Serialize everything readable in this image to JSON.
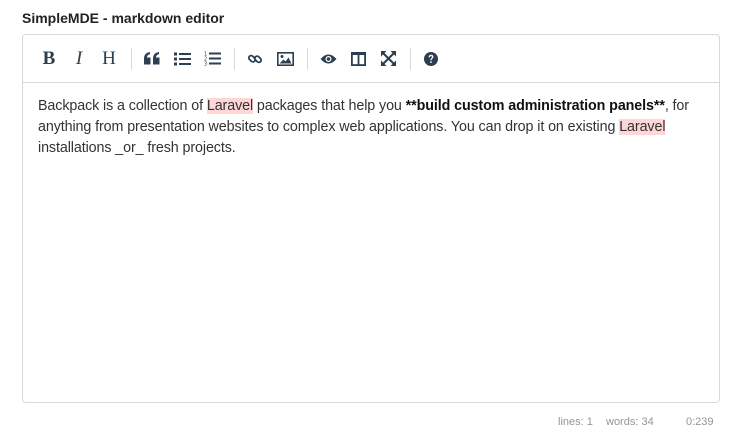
{
  "label": "SimpleMDE - markdown editor",
  "toolbar": {
    "bold": "B",
    "italic": "I",
    "heading": "H"
  },
  "content": {
    "p1": "Backpack is a collection of ",
    "w1": "Laravel",
    "p2": " packages that help you ",
    "bold_text": "**build custom  administration panels**",
    "p3": ", for anything from presentation websites to complex web applications. You can drop it on existing ",
    "w2": "Laravel",
    "p4": " installations _or_ fresh projects."
  },
  "status": {
    "lines": "lines: 1",
    "words": "words: 34",
    "cursor": "0:239"
  },
  "colors": {
    "icon": "#2c3e50",
    "spellcheck_highlight": "#ffd6d6",
    "border": "#d8d8d8"
  }
}
